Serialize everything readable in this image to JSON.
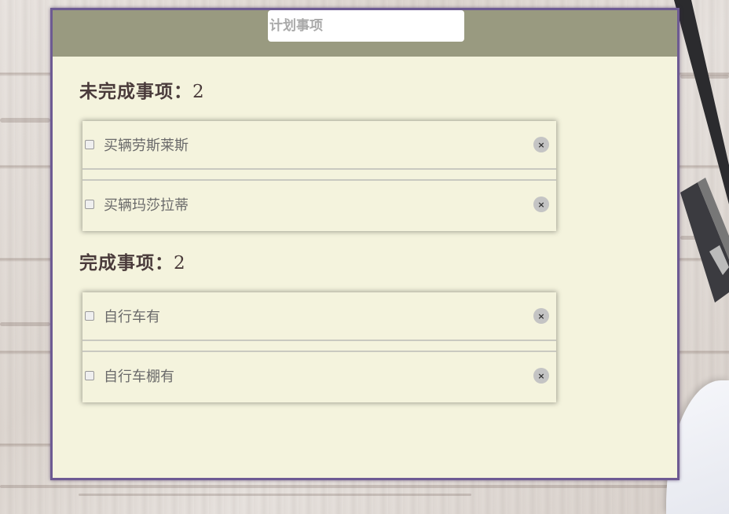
{
  "header": {
    "input_placeholder": "计划事项",
    "input_value": ""
  },
  "pending": {
    "title": "未完成事项：",
    "count": "2",
    "items": [
      {
        "text": "买辆劳斯莱斯",
        "checked": false,
        "delete_label": "×"
      },
      {
        "text": "买辆玛莎拉蒂",
        "checked": false,
        "delete_label": "×"
      }
    ]
  },
  "done": {
    "title": "完成事项：",
    "count": "2",
    "items": [
      {
        "text": "自行车有",
        "checked": false,
        "delete_label": "×"
      },
      {
        "text": "自行车棚有",
        "checked": false,
        "delete_label": "×"
      }
    ]
  },
  "colors": {
    "card_bg": "#f4f3dd",
    "header_bg": "#999a80",
    "card_border": "#6d5a93",
    "title_text": "#4a3b3b",
    "item_text": "#6a6a6a"
  }
}
